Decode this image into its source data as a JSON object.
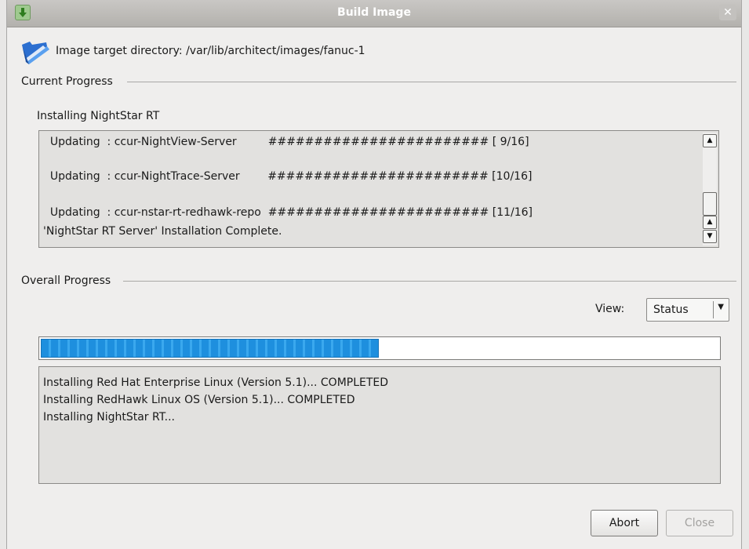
{
  "window": {
    "title": "Build Image",
    "close_glyph": "✕",
    "icon": "download-arrow-icon"
  },
  "target": {
    "icon": "folder-icon",
    "text": "Image target directory: /var/lib/architect/images/fanuc-1"
  },
  "current_progress": {
    "label": "Current Progress",
    "step": "Installing NightStar RT",
    "log_lines": [
      "  Updating  : ccur-NightView-Server         ######################## [ 9/16]",
      "  Updating  : ccur-NightTrace-Server        ######################## [10/16]",
      "  Updating  : ccur-nstar-rt-redhawk-repo  ######################## [11/16]",
      "'NightStar RT Server' Installation Complete."
    ]
  },
  "overall_progress": {
    "label": "Overall Progress",
    "view_label": "View:",
    "view_value": "Status",
    "progress_fraction": 0.499,
    "status_lines": [
      "Installing Red Hat Enterprise Linux (Version 5.1)... COMPLETED",
      "Installing RedHawk Linux OS (Version 5.1)... COMPLETED",
      "Installing NightStar RT..."
    ]
  },
  "buttons": {
    "abort": "Abort",
    "close": "Close"
  },
  "colors": {
    "progress": "#1e8fde",
    "title_text": "#ffffff"
  }
}
